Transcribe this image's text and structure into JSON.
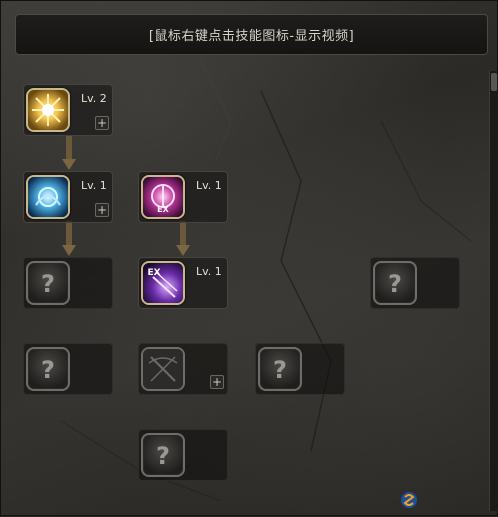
{
  "header": {
    "hint": "[鼠标右键点击技能图标-显示视频]"
  },
  "skills": {
    "row1_skill": {
      "level": "Lv. 2",
      "plus": "+"
    },
    "row2_blue_skill": {
      "level": "Lv. 1",
      "plus": "+"
    },
    "row2_pink_skill": {
      "level": "Lv. 1"
    },
    "row3_ex_skill": {
      "level": "Lv. 1"
    },
    "row4_crossbow_skill": {
      "plus": "+"
    }
  },
  "unknown_glyph": "?",
  "ex_badge": "EX",
  "colors": {
    "frame_gold": "#c8b98a",
    "unknown_frame": "#6f6d69",
    "background": "#2e2d2a"
  }
}
